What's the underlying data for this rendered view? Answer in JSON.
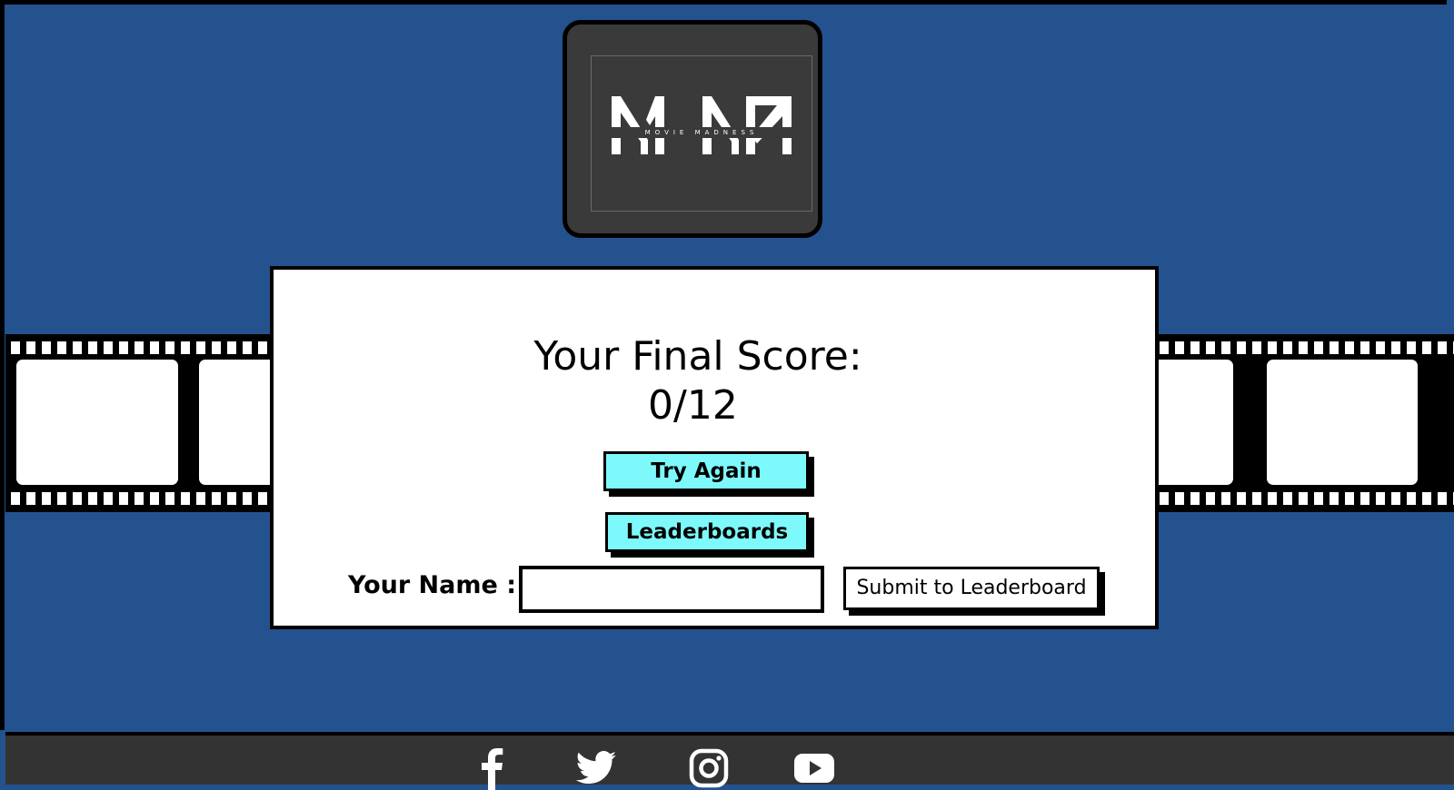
{
  "logo": {
    "monogram": "MM",
    "tagline": "MOVIE MADNESS"
  },
  "result": {
    "title": "Your Final Score:",
    "score": "0/12"
  },
  "actions": {
    "try_again_label": "Try Again",
    "leaderboards_label": "Leaderboards"
  },
  "submission": {
    "name_label": "Your Name :",
    "name_value": "",
    "submit_label": "Submit to Leaderboard"
  },
  "footer": {
    "social_icons": [
      "facebook-icon",
      "twitter-icon",
      "instagram-icon",
      "youtube-icon"
    ]
  },
  "colors": {
    "background": "#24528f",
    "button_accent": "#7df9fc",
    "footer": "#333333"
  }
}
